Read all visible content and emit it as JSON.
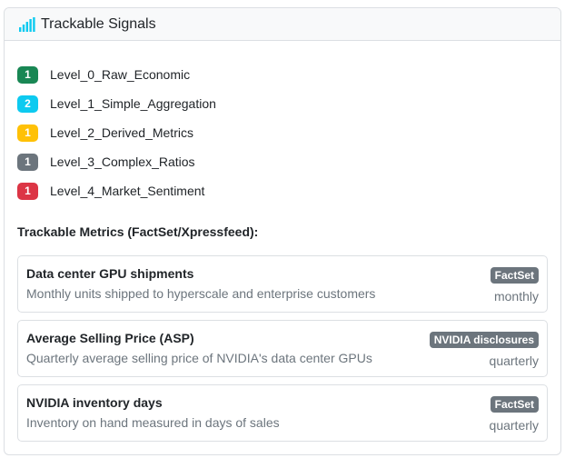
{
  "header": {
    "title": "Trackable Signals",
    "icon": "signal-bars-icon",
    "accent": "#0dcaf0"
  },
  "levels": [
    {
      "count": "1",
      "label": "Level_0_Raw_Economic",
      "color": "#198754"
    },
    {
      "count": "2",
      "label": "Level_1_Simple_Aggregation",
      "color": "#0dcaf0"
    },
    {
      "count": "1",
      "label": "Level_2_Derived_Metrics",
      "color": "#ffc107"
    },
    {
      "count": "1",
      "label": "Level_3_Complex_Ratios",
      "color": "#6c757d"
    },
    {
      "count": "1",
      "label": "Level_4_Market_Sentiment",
      "color": "#dc3545"
    }
  ],
  "metrics_heading": "Trackable Metrics (FactSet/Xpressfeed):",
  "metrics": [
    {
      "name": "Data center GPU shipments",
      "description": "Monthly units shipped to hyperscale and enterprise customers",
      "source": "FactSet",
      "frequency": "monthly"
    },
    {
      "name": "Average Selling Price (ASP)",
      "description": "Quarterly average selling price of NVIDIA's data center GPUs",
      "source": "NVIDIA disclosures",
      "frequency": "quarterly"
    },
    {
      "name": "NVIDIA inventory days",
      "description": "Inventory on hand measured in days of sales",
      "source": "FactSet",
      "frequency": "quarterly"
    }
  ]
}
